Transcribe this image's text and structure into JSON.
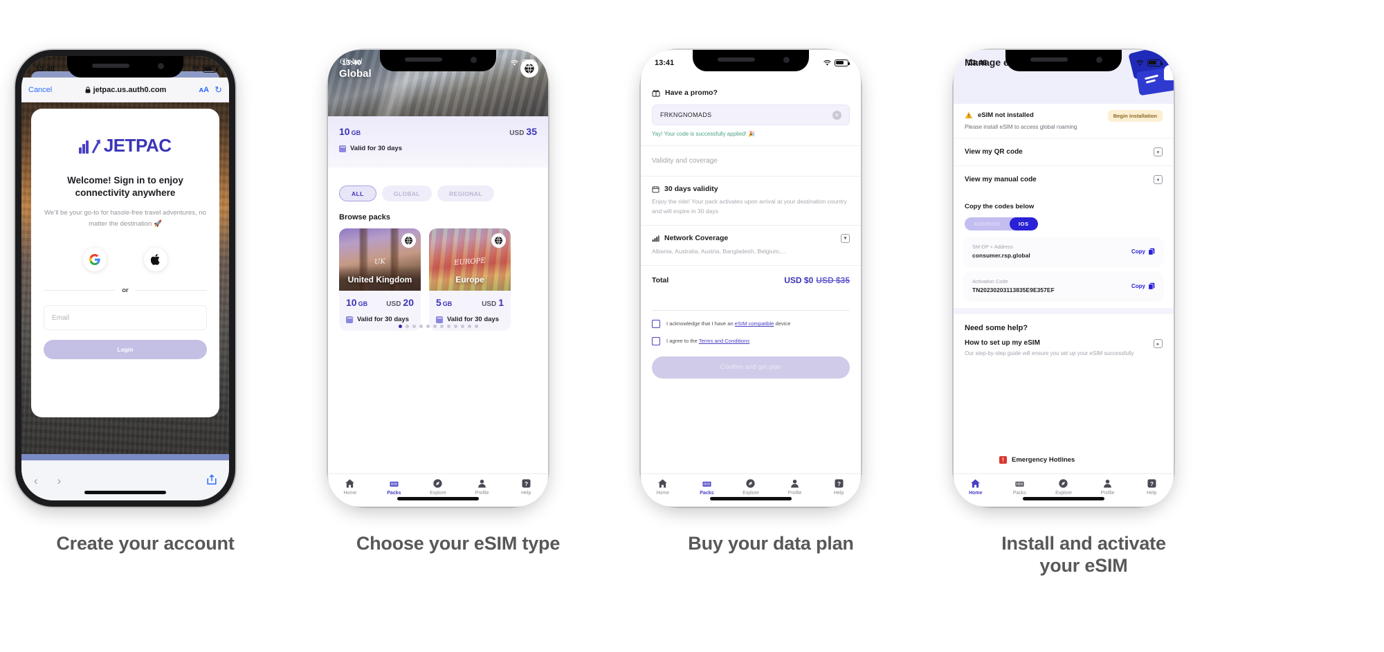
{
  "steps": [
    {
      "caption": "Create your account"
    },
    {
      "caption": "Choose your eSIM type"
    },
    {
      "caption": "Buy your data plan"
    },
    {
      "caption": "Install and activate\nyour eSIM"
    }
  ],
  "phone1": {
    "status_time": "13:40",
    "safari": {
      "cancel_label": "Cancel",
      "url": "jetpac.us.auth0.com",
      "lock_icon": "lock-icon",
      "text_size_label": "ᴀA",
      "reload_icon": "reload-icon",
      "back_icon": "chevron-left-icon",
      "forward_icon": "chevron-right-icon",
      "share_icon": "share-icon"
    },
    "brand": "JETPAC",
    "heading": "Welcome! Sign in to enjoy connectivity anywhere",
    "subheading": "We’ll be your go-to for hassle-free travel adventures, no matter the destination 🚀",
    "google_label": "google-signin",
    "apple_label": "apple-signin",
    "divider_label": "or",
    "email_placeholder": "Email",
    "login_label": "Login"
  },
  "phone2": {
    "status_time": "13:40",
    "hero_script": "Global",
    "hero_title": "Global",
    "pack": {
      "data": "10",
      "data_unit": "GB",
      "currency": "USD",
      "price": "35",
      "validity": "Valid for 30 days"
    },
    "chips": [
      {
        "label": "ALL",
        "active": true
      },
      {
        "label": "GLOBAL",
        "active": false
      },
      {
        "label": "REGIONAL",
        "active": false
      }
    ],
    "browse_title": "Browse packs",
    "cards": [
      {
        "script": "UK",
        "title": "United Kingdom",
        "data": "10",
        "data_unit": "GB",
        "currency": "USD",
        "price": "20",
        "validity": "Valid for 30 days"
      },
      {
        "script": "EUROPE",
        "title": "Europe",
        "data": "5",
        "data_unit": "GB",
        "currency": "USD",
        "price": "1",
        "validity": "Valid for 30 days"
      }
    ],
    "dots_total": 12,
    "dots_active": 1
  },
  "phone3": {
    "status_time": "13:41",
    "promo_title": "Have a promo?",
    "promo_value": "FRKNGNOMADS",
    "promo_success": "Yay! Your code is successfully applied! 🎉",
    "section_title": "Validity and coverage",
    "validity_title": "30 days validity",
    "validity_text": "Enjoy the ride! Your pack activates upon arrival at your destination country and will expire in 30 days",
    "coverage_title": "Network Coverage",
    "coverage_text": "Albania, Australia, Austria, Bangladesh, Belgium,...",
    "total_label": "Total",
    "total_now": "USD $0",
    "total_was": "USD $35",
    "check1_pre": "I acknowledge that I have an ",
    "check1_link": "eSIM compatible",
    "check1_post": " device",
    "check2_pre": "I agree to the ",
    "check2_link": "Terms and Conditions",
    "cta_label": "Confirm and get plan"
  },
  "phone4": {
    "status_time": "13:48",
    "title": "Manage eSIM",
    "warn_title": "eSIM not installed",
    "warn_text": "Please install eSIM to access global roaming",
    "begin_label": "Begin installation",
    "rows": [
      {
        "label": "View my QR code"
      },
      {
        "label": "View my manual code"
      }
    ],
    "copy_title": "Copy the codes below",
    "segments": [
      {
        "label": "ANDROID",
        "active": false
      },
      {
        "label": "IOS",
        "active": true
      }
    ],
    "codes": [
      {
        "label": "SM-DP + Address",
        "value": "consumer.rsp.global",
        "action": "Copy"
      },
      {
        "label": "Activation Code",
        "value": "TN20230203113835E9E357EF",
        "action": "Copy"
      }
    ],
    "help_title": "Need some help?",
    "help_item_title": "How to set up my eSIM",
    "help_item_text": "Our step-by-step guide will ensure you set up your eSIM successfully",
    "emergency_label": "Emergency Hotlines"
  },
  "tabbar": [
    {
      "label": "Home",
      "icon": "home-icon"
    },
    {
      "label": "Packs",
      "icon": "packs-icon"
    },
    {
      "label": "Explore",
      "icon": "explore-icon"
    },
    {
      "label": "Profile",
      "icon": "profile-icon"
    },
    {
      "label": "Help",
      "icon": "help-icon"
    }
  ],
  "colors": {
    "brand": "#3b34b8",
    "accent": "#2a21d6",
    "muted": "#a4a4ae",
    "success": "#4ba37f",
    "warning": "#e8b53a",
    "danger": "#d7372f"
  }
}
